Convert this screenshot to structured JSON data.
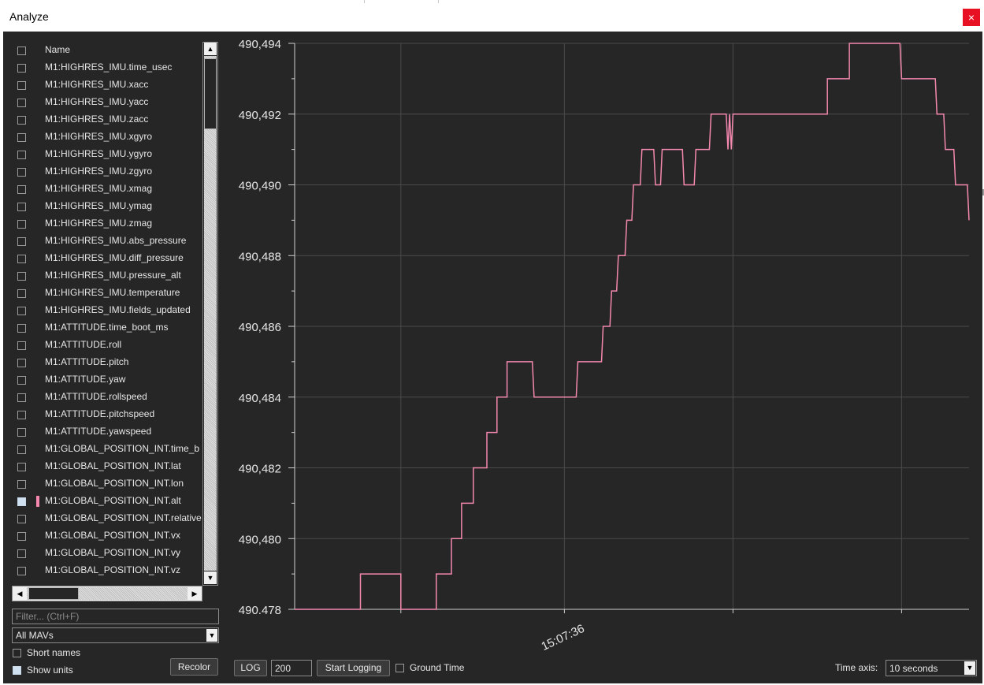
{
  "window": {
    "title": "Analyze",
    "close_glyph": "×"
  },
  "list": {
    "header": "Name",
    "items": [
      {
        "label": "M1:HIGHRES_IMU.time_usec",
        "checked": false
      },
      {
        "label": "M1:HIGHRES_IMU.xacc",
        "checked": false
      },
      {
        "label": "M1:HIGHRES_IMU.yacc",
        "checked": false
      },
      {
        "label": "M1:HIGHRES_IMU.zacc",
        "checked": false
      },
      {
        "label": "M1:HIGHRES_IMU.xgyro",
        "checked": false
      },
      {
        "label": "M1:HIGHRES_IMU.ygyro",
        "checked": false
      },
      {
        "label": "M1:HIGHRES_IMU.zgyro",
        "checked": false
      },
      {
        "label": "M1:HIGHRES_IMU.xmag",
        "checked": false
      },
      {
        "label": "M1:HIGHRES_IMU.ymag",
        "checked": false
      },
      {
        "label": "M1:HIGHRES_IMU.zmag",
        "checked": false
      },
      {
        "label": "M1:HIGHRES_IMU.abs_pressure",
        "checked": false
      },
      {
        "label": "M1:HIGHRES_IMU.diff_pressure",
        "checked": false
      },
      {
        "label": "M1:HIGHRES_IMU.pressure_alt",
        "checked": false
      },
      {
        "label": "M1:HIGHRES_IMU.temperature",
        "checked": false
      },
      {
        "label": "M1:HIGHRES_IMU.fields_updated",
        "checked": false
      },
      {
        "label": "M1:ATTITUDE.time_boot_ms",
        "checked": false
      },
      {
        "label": "M1:ATTITUDE.roll",
        "checked": false
      },
      {
        "label": "M1:ATTITUDE.pitch",
        "checked": false
      },
      {
        "label": "M1:ATTITUDE.yaw",
        "checked": false
      },
      {
        "label": "M1:ATTITUDE.rollspeed",
        "checked": false
      },
      {
        "label": "M1:ATTITUDE.pitchspeed",
        "checked": false
      },
      {
        "label": "M1:ATTITUDE.yawspeed",
        "checked": false
      },
      {
        "label": "M1:GLOBAL_POSITION_INT.time_b",
        "checked": false
      },
      {
        "label": "M1:GLOBAL_POSITION_INT.lat",
        "checked": false
      },
      {
        "label": "M1:GLOBAL_POSITION_INT.lon",
        "checked": false
      },
      {
        "label": "M1:GLOBAL_POSITION_INT.alt",
        "checked": true,
        "color": "#f488ae"
      },
      {
        "label": "M1:GLOBAL_POSITION_INT.relative",
        "checked": false
      },
      {
        "label": "M1:GLOBAL_POSITION_INT.vx",
        "checked": false
      },
      {
        "label": "M1:GLOBAL_POSITION_INT.vy",
        "checked": false
      },
      {
        "label": "M1:GLOBAL_POSITION_INT.vz",
        "checked": false
      }
    ]
  },
  "filter": {
    "placeholder": "Filter... (Ctrl+F)"
  },
  "mav_select": {
    "value": "All MAVs"
  },
  "options": {
    "short_names": "Short names",
    "show_units": "Show units",
    "show_units_checked": true,
    "short_names_checked": false
  },
  "buttons": {
    "recolor": "Recolor",
    "log": "LOG",
    "start_logging": "Start Logging"
  },
  "log_interval": "200",
  "ground_time": {
    "label": "Ground Time",
    "checked": false
  },
  "time_axis": {
    "label": "Time axis:",
    "value": "10 seconds"
  },
  "colors": {
    "background": "#262626",
    "series": "#f488ae",
    "grid": "#4a4a4a"
  },
  "chart_data": {
    "type": "line",
    "series": [
      {
        "name": "M1:GLOBAL_POSITION_INT.alt",
        "color": "#f488ae",
        "points": [
          [
            0.0,
            490.478
          ],
          [
            3.9,
            490.478
          ],
          [
            3.9,
            490.479
          ],
          [
            6.3,
            490.479
          ],
          [
            6.3,
            490.478
          ],
          [
            8.4,
            490.478
          ],
          [
            8.4,
            490.479
          ],
          [
            9.3,
            490.479
          ],
          [
            9.3,
            490.48
          ],
          [
            9.9,
            490.48
          ],
          [
            9.9,
            490.481
          ],
          [
            10.6,
            490.481
          ],
          [
            10.6,
            490.482
          ],
          [
            11.4,
            490.482
          ],
          [
            11.4,
            490.483
          ],
          [
            12.0,
            490.483
          ],
          [
            12.0,
            490.484
          ],
          [
            12.6,
            490.484
          ],
          [
            12.6,
            490.485
          ],
          [
            14.1,
            490.485
          ],
          [
            14.2,
            490.484
          ],
          [
            16.7,
            490.484
          ],
          [
            16.8,
            490.485
          ],
          [
            18.2,
            490.485
          ],
          [
            18.3,
            490.486
          ],
          [
            18.7,
            490.486
          ],
          [
            18.8,
            490.487
          ],
          [
            19.1,
            490.487
          ],
          [
            19.2,
            490.488
          ],
          [
            19.6,
            490.488
          ],
          [
            19.7,
            490.489
          ],
          [
            20.0,
            490.489
          ],
          [
            20.1,
            490.49
          ],
          [
            20.5,
            490.49
          ],
          [
            20.6,
            490.491
          ],
          [
            21.3,
            490.491
          ],
          [
            21.4,
            490.49
          ],
          [
            21.7,
            490.49
          ],
          [
            21.8,
            490.491
          ],
          [
            23.0,
            490.491
          ],
          [
            23.1,
            490.49
          ],
          [
            23.7,
            490.49
          ],
          [
            23.8,
            490.491
          ],
          [
            24.6,
            490.491
          ],
          [
            24.7,
            490.492
          ],
          [
            25.6,
            490.492
          ],
          [
            25.7,
            490.491
          ],
          [
            25.8,
            490.492
          ],
          [
            25.9,
            490.491
          ],
          [
            26.0,
            490.492
          ],
          [
            31.6,
            490.492
          ],
          [
            31.6,
            490.493
          ],
          [
            32.9,
            490.493
          ],
          [
            32.9,
            490.494
          ],
          [
            35.9,
            490.494
          ],
          [
            36.0,
            490.493
          ],
          [
            38.0,
            490.493
          ],
          [
            38.1,
            490.492
          ],
          [
            38.5,
            490.492
          ],
          [
            38.6,
            490.491
          ],
          [
            39.1,
            490.491
          ],
          [
            39.2,
            490.49
          ],
          [
            39.9,
            490.49
          ],
          [
            40.0,
            490.489
          ]
        ]
      }
    ],
    "x_tick_labels": [
      {
        "x": 16.0,
        "label": "15:07:36"
      }
    ],
    "xlim": [
      0,
      40
    ],
    "ylim": [
      490.478,
      490.494
    ],
    "y_ticks": [
      490.478,
      490.48,
      490.482,
      490.484,
      490.486,
      490.488,
      490.49,
      490.492,
      490.494
    ],
    "y_tick_labels": [
      "490.478",
      "490,480",
      "490,482",
      "490,484",
      "490,486",
      "490,488",
      "490,490",
      "490,492",
      "490,494"
    ],
    "grid": true
  }
}
